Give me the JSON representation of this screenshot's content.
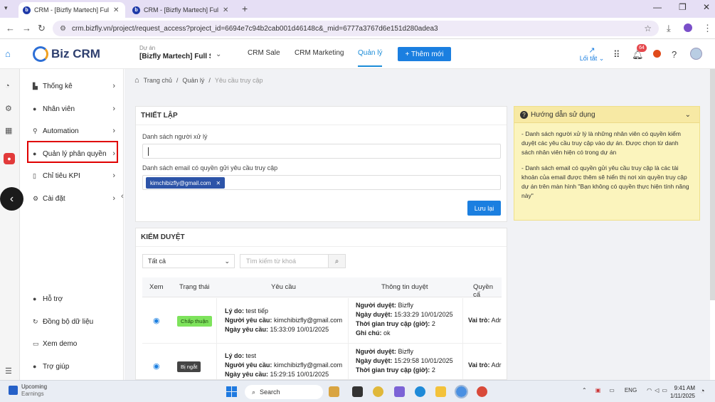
{
  "browser": {
    "tabs": [
      {
        "label": "CRM - [Bizfly Martech] Full Solut",
        "active": true
      },
      {
        "label": "CRM - [Bizfly Martech] Full Solut",
        "active": false
      }
    ],
    "url": "crm.bizfly.vn/project/request_access?project_id=6694e7c94b2cab001d46148c&_mid=6777a3767d6e151d280adea3"
  },
  "header": {
    "logo": "Biz CRM",
    "project_label": "Dự án",
    "project_value": "[Bizfly Martech] Full Solut",
    "nav": [
      "CRM Sale",
      "CRM Marketing",
      "Quản lý"
    ],
    "active_nav": "Quản lý",
    "add_new": "+ Thêm mới",
    "shortcut": "Lối tắt",
    "notif_count": "64"
  },
  "sidebar": {
    "items": [
      {
        "label": "Thống kê",
        "icon": "bar-chart-icon"
      },
      {
        "label": "Nhân viên",
        "icon": "user-icon"
      },
      {
        "label": "Automation",
        "icon": "automation-icon"
      },
      {
        "label": "Quản lý phân quyền",
        "icon": "user-lock-icon"
      },
      {
        "label": "Chỉ tiêu KPI",
        "icon": "kpi-icon"
      },
      {
        "label": "Cài đặt",
        "icon": "gear-icon"
      }
    ],
    "bottom": [
      {
        "label": "Hỗ trợ",
        "icon": "support-icon"
      },
      {
        "label": "Đồng bộ dữ liệu",
        "icon": "sync-icon"
      },
      {
        "label": "Xem demo",
        "icon": "demo-icon"
      },
      {
        "label": "Trợ giúp",
        "icon": "help-icon"
      }
    ]
  },
  "breadcrumb": [
    "Trang chủ",
    "Quản lý",
    "Yêu cầu truy cập"
  ],
  "setup": {
    "title": "THIẾT LẬP",
    "handlers_label": "Danh sách người xử lý",
    "handlers_value": "",
    "emails_label": "Danh sách email có quyền gửi yêu cầu truy cập",
    "email_chip": "kimchibizfly@gmail.com",
    "save": "Lưu lại"
  },
  "guide": {
    "title": "Hướng dẫn sử dụng",
    "p1": "- Danh sách người xử lý là những nhân viên có quyền kiểm duyệt các yêu cầu truy cập vào dự án. Được chọn từ danh sách nhân viên hiện có trong dự án",
    "p2": "- Danh sách email có quyền gửi yêu cầu truy cập là các tài khoản của email được thêm sẽ hiển thị nơi xin quyền truy cập dự án trên màn hình \"Bạn không có quyền thực hiện tính năng này\""
  },
  "review": {
    "title": "KIỂM DUYỆT",
    "filter": "Tất cả",
    "search_placeholder": "Tìm kiếm từ khoá",
    "columns": [
      "Xem",
      "Trạng thái",
      "Yêu cầu",
      "Thông tin duyệt",
      "Quyền cấ"
    ],
    "rows": [
      {
        "status": "Chấp thuận",
        "status_type": "approve",
        "reason_label": "Lý do:",
        "reason": "test tiếp",
        "requester_label": "Người yêu cầu:",
        "requester": "kimchibizfly@gmail.com",
        "date_label": "Ngày yêu cầu:",
        "date": "15:33:09 10/01/2025",
        "approver_label": "Người duyệt:",
        "approver": "Bizfly",
        "approve_date_label": "Ngày duyệt:",
        "approve_date": "15:33:29 10/01/2025",
        "duration_label": "Thời gian truy cập (giờ):",
        "duration": "2",
        "note_label": "Ghi chú:",
        "note": "ok",
        "role_label": "Vai trò:",
        "role": "Adr"
      },
      {
        "status": "Bị ngắt",
        "status_type": "stopped",
        "reason_label": "Lý do:",
        "reason": "test",
        "requester_label": "Người yêu cầu:",
        "requester": "kimchibizfly@gmail.com",
        "date_label": "Ngày yêu cầu:",
        "date": "15:29:15 10/01/2025",
        "approver_label": "Người duyệt:",
        "approver": "Bizfly",
        "approve_date_label": "Ngày duyệt:",
        "approve_date": "15:29:58 10/01/2025",
        "duration_label": "Thời gian truy cập (giờ):",
        "duration": "2",
        "role_label": "Vai trò:",
        "role": "Adr"
      }
    ]
  },
  "taskbar": {
    "weather_title": "Upcoming",
    "weather_sub": "Earnings",
    "search": "Search",
    "lang": "ENG",
    "time": "9:41 AM",
    "date": "1/11/2025"
  },
  "colors": {
    "accent": "#1b7fe0",
    "highlight": "#e00000",
    "guide_bg": "#fbf4bd"
  }
}
